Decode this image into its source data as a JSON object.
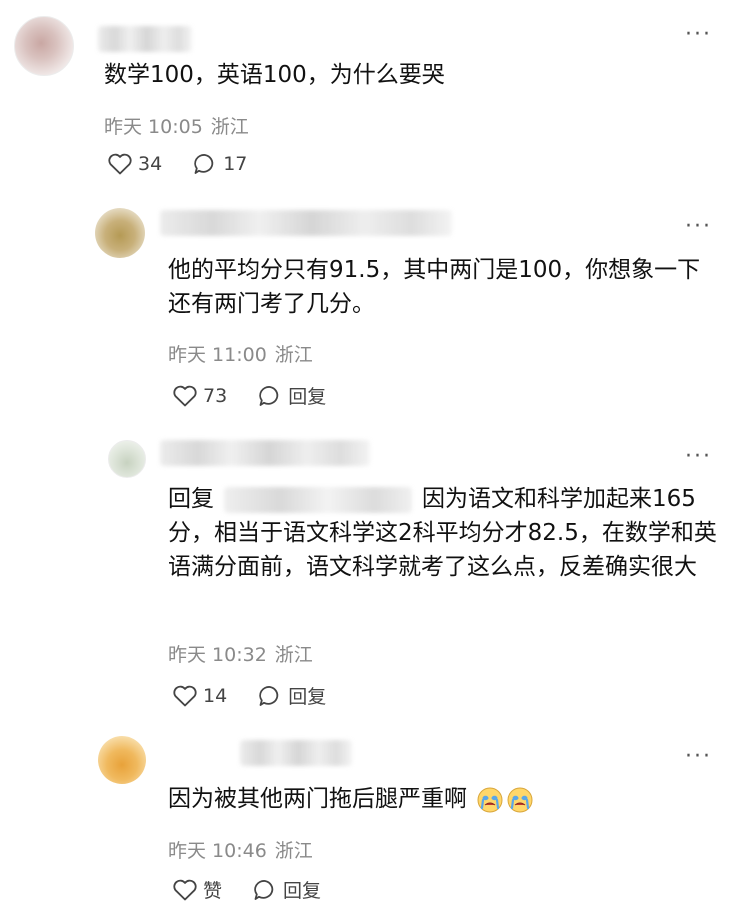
{
  "comments": [
    {
      "text": "数学100，英语100，为什么要哭",
      "time": "昨天 10:05",
      "location": "浙江",
      "likes": "34",
      "replies": "17"
    },
    {
      "text": "他的平均分只有91.5，其中两门是100，你想象一下还有两门考了几分。",
      "time": "昨天 11:00",
      "location": "浙江",
      "likes": "73",
      "reply_label": "回复"
    },
    {
      "reply_prefix": "回复",
      "text": "因为语文和科学加起来165分，相当于语文科学这2科平均分才82.5，在数学和英语满分面前，语文科学就考了这么点，反差确实很大",
      "time": "昨天 10:32",
      "location": "浙江",
      "likes": "14",
      "reply_label": "回复"
    },
    {
      "text": "因为被其他两门拖后腿严重啊",
      "time": "昨天 10:46",
      "location": "浙江",
      "likes": "赞",
      "reply_label": "回复"
    }
  ],
  "icons": {
    "like": "heart-outline-icon",
    "comment": "speech-bubble-icon",
    "more": "more-dots-icon",
    "emoji": "crying-face-emoji"
  },
  "colors": {
    "text": "#111111",
    "meta": "#8a8a8a"
  }
}
